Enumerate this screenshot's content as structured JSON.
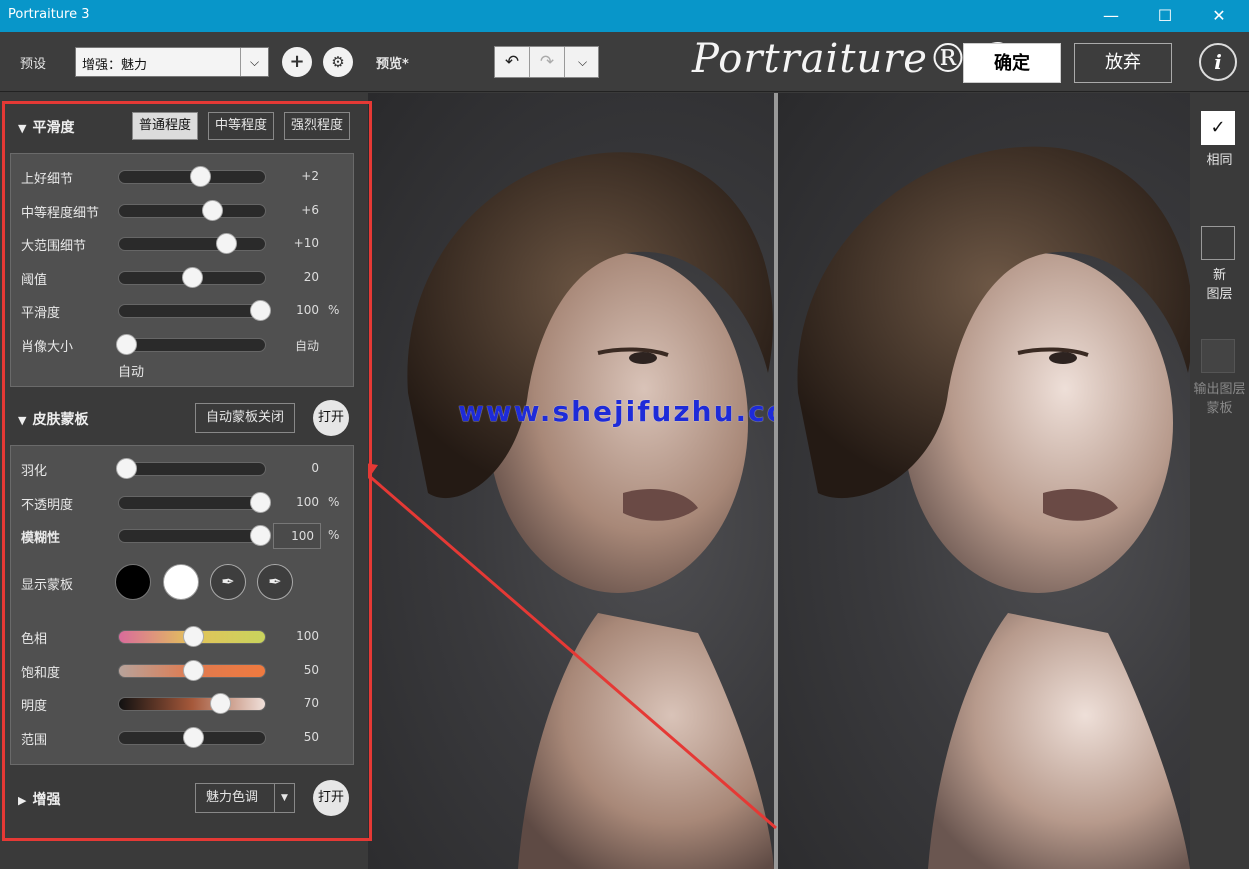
{
  "window": {
    "title": "Portraiture 3",
    "controls": {
      "minimize": "—",
      "maximize": "☐",
      "close": "✕"
    }
  },
  "toolbar": {
    "preset_label": "预设",
    "preset_value": "增强：魅力",
    "preview_label": "预览*",
    "logo_text": "Portraiture® 3",
    "ok_label": "确定",
    "cancel_label": "放弃",
    "info_label": "i"
  },
  "smoothing": {
    "title": "平滑度",
    "modes": [
      "普通程度",
      "中等程度",
      "强烈程度"
    ],
    "active_mode": "普通程度",
    "rows": [
      {
        "label": "上好细节",
        "value": "+2",
        "unit": "",
        "position": 0.55
      },
      {
        "label": "中等程度细节",
        "value": "+6",
        "unit": "",
        "position": 0.63
      },
      {
        "label": "大范围细节",
        "value": "+10",
        "unit": "",
        "position": 0.72
      },
      {
        "label": "阈值",
        "value": "20",
        "unit": "",
        "position": 0.49
      },
      {
        "label": "平滑度",
        "value": "100",
        "unit": "%",
        "position": 0.95
      },
      {
        "label": "肖像大小",
        "value": "自动",
        "unit": "",
        "position": 0.05
      }
    ],
    "portrait_size_note": "自动"
  },
  "skin_mask": {
    "title": "皮肤蒙板",
    "auto_mask_label": "自动蒙板关闭",
    "open_label": "打开",
    "rows": [
      {
        "label": "羽化",
        "value": "0",
        "unit": "",
        "position": 0.05
      },
      {
        "label": "不透明度",
        "value": "100",
        "unit": "%",
        "position": 0.95
      },
      {
        "label": "模糊性",
        "value": "100",
        "unit": "%",
        "position": 0.95
      }
    ],
    "show_mask_label": "显示蒙板",
    "color_rows": [
      {
        "label": "色相",
        "value": "100",
        "position": 0.5,
        "gradient": [
          "#d96b9b",
          "#e3c35a",
          "#c9d45d"
        ]
      },
      {
        "label": "饱和度",
        "value": "50",
        "position": 0.5,
        "gradient": [
          "#b7a39b",
          "#e07a4f",
          "#f07a3f"
        ]
      },
      {
        "label": "明度",
        "value": "70",
        "position": 0.68,
        "gradient": [
          "#111111",
          "#a5583a",
          "#f0e0da"
        ]
      },
      {
        "label": "范围",
        "value": "50",
        "position": 0.5,
        "gradient": [
          "#2a2a2a",
          "#2a2a2a",
          "#2a2a2a"
        ]
      }
    ]
  },
  "enhance": {
    "title": "增强",
    "preset_label": "魅力色调",
    "open_label": "打开"
  },
  "preview": {
    "watermark": "www.shejifuzhu.com"
  },
  "right_panel": {
    "same_label": "相同",
    "new_layer_label_1": "新",
    "new_layer_label_2": "图层",
    "output_mask_label_1": "输出图层",
    "output_mask_label_2": "蒙板"
  }
}
